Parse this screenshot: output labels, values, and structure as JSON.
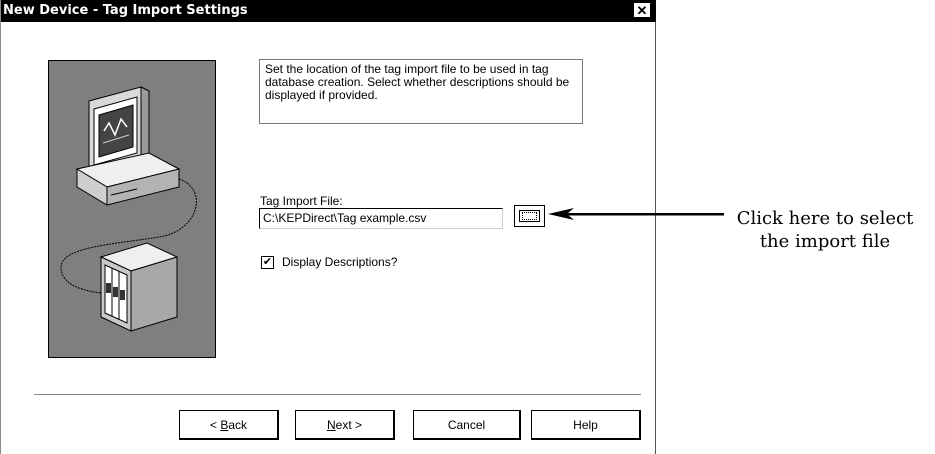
{
  "window": {
    "title": "New Device - Tag Import Settings",
    "close_glyph": "✕"
  },
  "description": "Set the location of the tag import file to be used in tag database creation.  Select whether descriptions should be displayed if provided.",
  "tag_import": {
    "label": "Tag Import File:",
    "value": "C:\\KEPDirect\\Tag example.csv"
  },
  "display_descriptions": {
    "label": "Display Descriptions?",
    "checked": true,
    "check_glyph": "✔"
  },
  "buttons": {
    "back_prefix": "< ",
    "back_mnemonic": "B",
    "back_rest": "ack",
    "next_mnemonic": "N",
    "next_rest": "ext >",
    "cancel": "Cancel",
    "help": "Help"
  },
  "callout": {
    "line1": "Click here to select",
    "line2": "the import file"
  },
  "icons": [
    "close-icon",
    "computer-illustration",
    "plc-rack-illustration",
    "browse-icon",
    "checkmark-icon",
    "arrow-icon"
  ]
}
